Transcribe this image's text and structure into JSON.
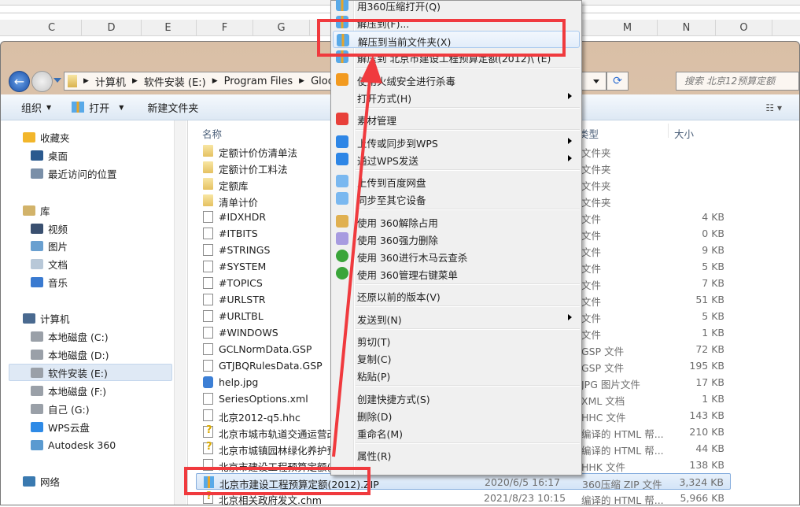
{
  "excel": {
    "columns": [
      "C",
      "D",
      "E",
      "F",
      "G",
      "M",
      "N",
      "O"
    ]
  },
  "explorer": {
    "breadcrumb": [
      "计算机",
      "软件安装 (E:)",
      "Program Files",
      "Glodo"
    ],
    "search_placeholder": "搜索 北京12预算定额",
    "toolbar": {
      "organize": "组织",
      "open": "打开",
      "new_folder": "新建文件夹"
    },
    "columns": {
      "name": "名称",
      "type": "类型",
      "size": "大小"
    },
    "nav": [
      {
        "label": "收藏夹",
        "icon": "star-icon",
        "group": true
      },
      {
        "label": "桌面",
        "icon": "desktop-icon"
      },
      {
        "label": "最近访问的位置",
        "icon": "recent-places-icon"
      },
      {
        "label": "库",
        "icon": "library-icon",
        "group": true
      },
      {
        "label": "视频",
        "icon": "video-icon"
      },
      {
        "label": "图片",
        "icon": "pictures-icon"
      },
      {
        "label": "文档",
        "icon": "documents-icon"
      },
      {
        "label": "音乐",
        "icon": "music-icon"
      },
      {
        "label": "计算机",
        "icon": "computer-icon",
        "group": true
      },
      {
        "label": "本地磁盘 (C:)",
        "icon": "drive-icon"
      },
      {
        "label": "本地磁盘 (D:)",
        "icon": "drive-icon"
      },
      {
        "label": "软件安装 (E:)",
        "icon": "drive-icon",
        "selected": true
      },
      {
        "label": "本地磁盘 (F:)",
        "icon": "drive-icon"
      },
      {
        "label": "自己 (G:)",
        "icon": "drive-icon"
      },
      {
        "label": "WPS云盘",
        "icon": "cloud-icon"
      },
      {
        "label": "Autodesk 360",
        "icon": "autodesk-icon"
      },
      {
        "label": "网络",
        "icon": "network-icon",
        "group": true
      }
    ],
    "files": [
      {
        "name": "定额计价仿清单法",
        "type": "文件夹",
        "size": "",
        "kind": "folder"
      },
      {
        "name": "定额计价工料法",
        "type": "文件夹",
        "size": "",
        "kind": "folder"
      },
      {
        "name": "定额库",
        "type": "文件夹",
        "size": "",
        "kind": "folder"
      },
      {
        "name": "清单计价",
        "type": "文件夹",
        "size": "",
        "kind": "folder"
      },
      {
        "name": "#IDXHDR",
        "type": "文件",
        "size": "4 KB",
        "kind": "file"
      },
      {
        "name": "#ITBITS",
        "type": "文件",
        "size": "0 KB",
        "kind": "file"
      },
      {
        "name": "#STRINGS",
        "type": "文件",
        "size": "9 KB",
        "kind": "file"
      },
      {
        "name": "#SYSTEM",
        "type": "文件",
        "size": "5 KB",
        "kind": "file"
      },
      {
        "name": "#TOPICS",
        "type": "文件",
        "size": "7 KB",
        "kind": "file"
      },
      {
        "name": "#URLSTR",
        "type": "文件",
        "size": "51 KB",
        "kind": "file"
      },
      {
        "name": "#URLTBL",
        "type": "文件",
        "size": "5 KB",
        "kind": "file"
      },
      {
        "name": "#WINDOWS",
        "type": "文件",
        "size": "1 KB",
        "kind": "file"
      },
      {
        "name": "GCLNormData.GSP",
        "type": "GSP 文件",
        "size": "72 KB",
        "kind": "file"
      },
      {
        "name": "GTJBQRulesData.GSP",
        "type": "GSP 文件",
        "size": "195 KB",
        "kind": "file"
      },
      {
        "name": "help.jpg",
        "type": "JPG 图片文件",
        "size": "17 KB",
        "kind": "jpg"
      },
      {
        "name": "SeriesOptions.xml",
        "type": "XML 文档",
        "size": "1 KB",
        "kind": "file"
      },
      {
        "name": "北京2012-q5.hhc",
        "type": "HHC 文件",
        "size": "143 KB",
        "kind": "file"
      },
      {
        "name": "北京市城市轨道交通运营改",
        "type": "编译的 HTML 帮...",
        "size": "210 KB",
        "kind": "chm"
      },
      {
        "name": "北京市城镇园林绿化养护预",
        "type": "编译的 HTML 帮...",
        "size": "44 KB",
        "kind": "chm"
      },
      {
        "name": "北京市建设工程预算定额(2",
        "type": "HHK 文件",
        "size": "138 KB",
        "kind": "file"
      },
      {
        "name": "北京市建设工程预算定额(2012).ZIP",
        "date": "2020/6/5 16:17",
        "type": "360压缩 ZIP 文件",
        "size": "3,324 KB",
        "kind": "zip",
        "selected": true
      },
      {
        "name": "北京相关政府发文.chm",
        "date": "2021/8/23 10:15",
        "type": "编译的 HTML 帮...",
        "size": "5,966 KB",
        "kind": "chm"
      }
    ]
  },
  "context_menu": [
    {
      "label": "用360压缩打开(Q)",
      "icon": "zip-icon"
    },
    {
      "label": "解压到(F)...",
      "icon": "zip-icon"
    },
    {
      "label": "解压到当前文件夹(X)",
      "icon": "zip-icon",
      "hover": true
    },
    {
      "label": "解压到 北京市建设工程预算定额(2012)\\ (E)",
      "icon": "zip-icon"
    },
    {
      "sep": true
    },
    {
      "label": "使用火绒安全进行杀毒",
      "icon": "huorong-shield-icon"
    },
    {
      "label": "打开方式(H)",
      "submenu": true
    },
    {
      "sep": true
    },
    {
      "label": "素材管理",
      "icon": "wps-icon"
    },
    {
      "sep": true
    },
    {
      "label": "上传或同步到WPS",
      "icon": "cloud-upload-icon",
      "submenu": true
    },
    {
      "label": "通过WPS发送",
      "icon": "send-icon",
      "submenu": true
    },
    {
      "sep": true
    },
    {
      "label": "上传到百度网盘",
      "icon": "baidu-netdisk-icon"
    },
    {
      "label": "同步至其它设备",
      "icon": "baidu-netdisk-icon"
    },
    {
      "sep": true
    },
    {
      "label": "使用 360解除占用",
      "icon": "unlock-folder-icon"
    },
    {
      "label": "使用 360强力删除",
      "icon": "shredder-icon"
    },
    {
      "label": "使用 360进行木马云查杀",
      "icon": "360-icon"
    },
    {
      "label": "使用 360管理右键菜单",
      "icon": "360-icon"
    },
    {
      "sep": true
    },
    {
      "label": "还原以前的版本(V)"
    },
    {
      "sep": true
    },
    {
      "label": "发送到(N)",
      "submenu": true
    },
    {
      "sep": true
    },
    {
      "label": "剪切(T)"
    },
    {
      "label": "复制(C)"
    },
    {
      "label": "粘贴(P)"
    },
    {
      "sep": true
    },
    {
      "label": "创建快捷方式(S)"
    },
    {
      "label": "删除(D)"
    },
    {
      "label": "重命名(M)"
    },
    {
      "sep": true
    },
    {
      "label": "属性(R)"
    }
  ],
  "colors": {
    "annotation_red": "#f03a3e",
    "selection": "#d3e4f7",
    "menu_bg": "#f0f0f0"
  }
}
